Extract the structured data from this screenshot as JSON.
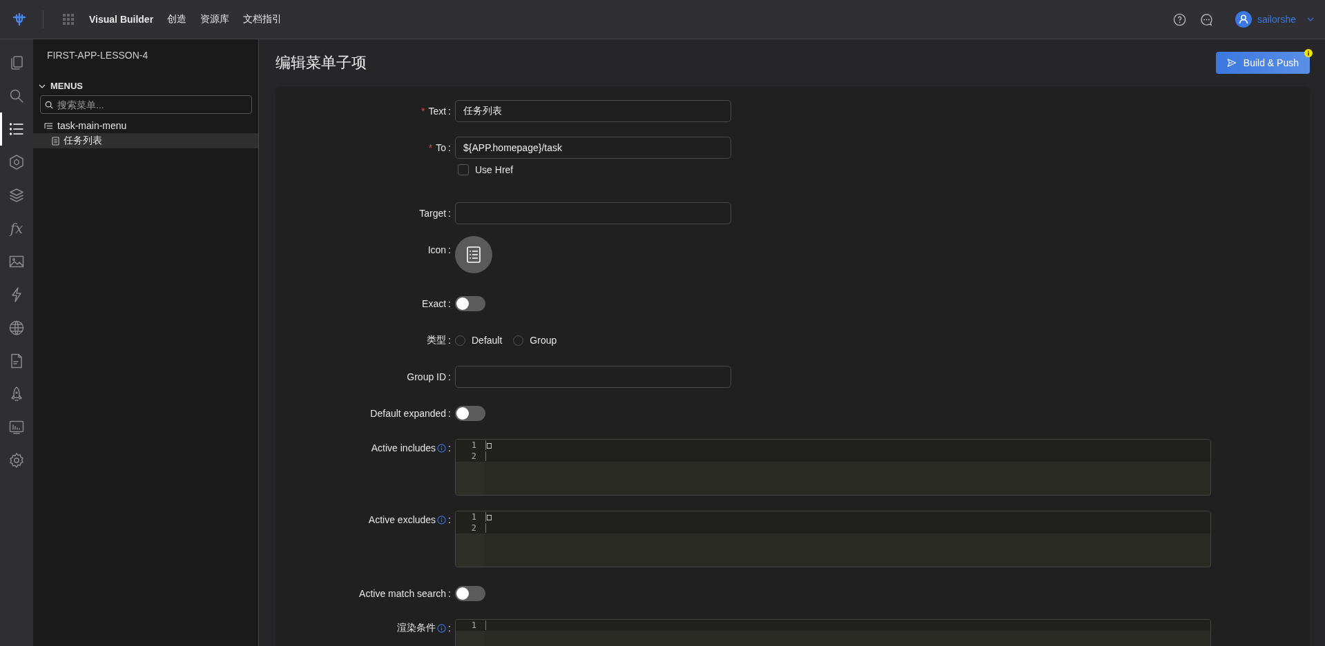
{
  "topbar": {
    "nav": [
      {
        "label": "Visual Builder",
        "selected": true
      },
      {
        "label": "创造",
        "selected": false
      },
      {
        "label": "资源库",
        "selected": false
      },
      {
        "label": "文档指引",
        "selected": false
      }
    ],
    "user": "sailorshe"
  },
  "rail": [
    {
      "kind": "pages",
      "selected": false
    },
    {
      "kind": "search",
      "selected": false
    },
    {
      "kind": "list",
      "selected": true
    },
    {
      "kind": "cube",
      "selected": false
    },
    {
      "kind": "layers",
      "selected": false
    },
    {
      "kind": "fx",
      "text": "fx",
      "selected": false
    },
    {
      "kind": "image",
      "selected": false
    },
    {
      "kind": "bolt",
      "selected": false
    },
    {
      "kind": "globe",
      "selected": false
    },
    {
      "kind": "doc",
      "selected": false
    },
    {
      "kind": "rocket",
      "selected": false
    },
    {
      "kind": "monitor",
      "selected": false
    },
    {
      "kind": "gear",
      "selected": false
    }
  ],
  "sidebar": {
    "project": "FIRST-APP-LESSON-4",
    "section": "MENUS",
    "expanded": true,
    "search": {
      "placeholder": "搜索菜单..."
    },
    "tree": [
      {
        "label": "task-main-menu",
        "kind": "menu",
        "selected": false,
        "children": [
          {
            "label": "任务列表",
            "kind": "item",
            "selected": true
          }
        ]
      }
    ]
  },
  "page": {
    "title": "编辑菜单子项",
    "button": "Build & Push"
  },
  "form": [
    {
      "kind": "input",
      "required_mark": "*",
      "label": "Text",
      "colon": ":",
      "value": "任务列表"
    },
    {
      "kind": "input",
      "required_mark": "*",
      "label": "To",
      "colon": ":",
      "value": "${APP.homepage}/task",
      "checkbox": {
        "label": "Use Href",
        "checked": false
      }
    },
    {
      "kind": "input",
      "label": "Target",
      "colon": ":"
    },
    {
      "kind": "icon",
      "label": "Icon",
      "colon": ":"
    },
    {
      "kind": "switch",
      "label": "Exact",
      "colon": ":",
      "on": false
    },
    {
      "kind": "radio",
      "label": "类型",
      "colon": ":",
      "options": [
        {
          "label": "Default",
          "selected": false
        },
        {
          "label": "Group",
          "selected": false
        }
      ]
    },
    {
      "kind": "input",
      "label": "Group ID",
      "colon": ":"
    },
    {
      "kind": "switch",
      "label": "Default expanded",
      "colon": ":",
      "on": false
    },
    {
      "kind": "code",
      "label": "Active includes",
      "info": true,
      "colon": ":",
      "lines": [
        {
          "number": "1",
          "text": "□"
        },
        {
          "number": "2"
        }
      ]
    },
    {
      "kind": "code",
      "label": "Active excludes",
      "info": true,
      "colon": ":",
      "lines": [
        {
          "number": "1",
          "text": "□"
        },
        {
          "number": "2"
        }
      ]
    },
    {
      "kind": "switch",
      "label": "Active match search",
      "colon": ":",
      "on": false
    },
    {
      "kind": "code",
      "label": "渲染条件",
      "info": true,
      "colon": ":",
      "lines": [
        {
          "number": "1"
        }
      ]
    }
  ]
}
